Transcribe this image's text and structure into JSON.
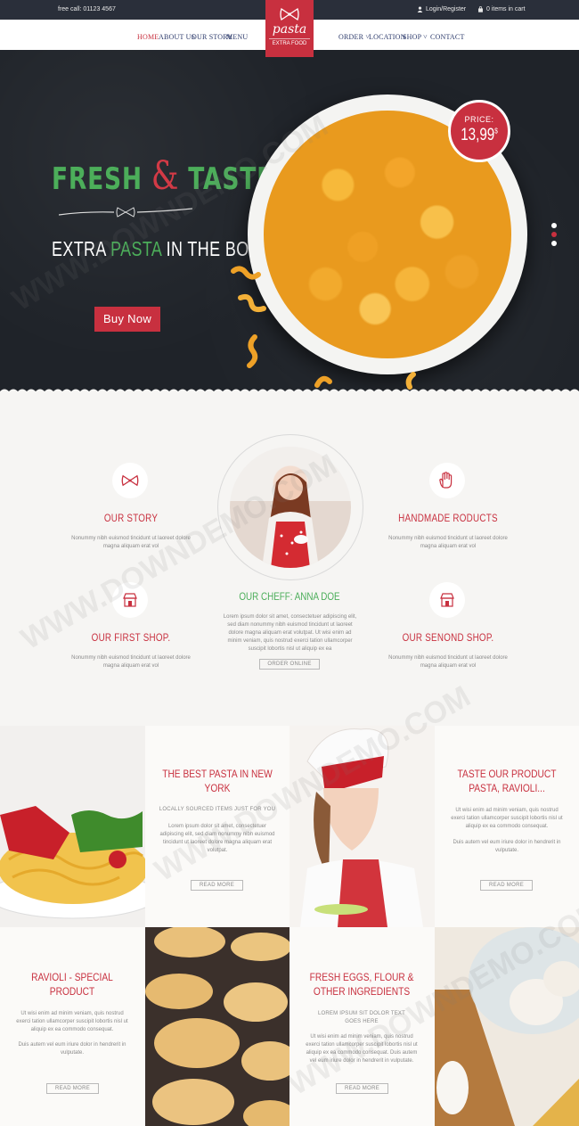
{
  "topbar": {
    "phone": "free call: 01123 4567",
    "login": "Login/Register",
    "cart": "0 items in cart"
  },
  "nav": {
    "left": [
      "HOME",
      "ABOUT US",
      "OUR STORY",
      "MENU"
    ],
    "right": [
      "ORDER",
      "LOCATION",
      "SHOP",
      "CONTACT"
    ],
    "active": "HOME"
  },
  "logo": {
    "name": "pasta",
    "sub": "EXTRA FOOD"
  },
  "hero": {
    "title_left": "FRESH",
    "title_amp": "&",
    "title_right": "TASTE",
    "sub_a": "EXTRA",
    "sub_hl": "PASTA",
    "sub_b": "IN THE BOX",
    "button": "Buy Now",
    "price_label": "PRICE:",
    "price_value": "13,99",
    "price_currency": "$"
  },
  "about": {
    "our_story": {
      "title": "OUR STORY",
      "text": "Nonummy nibh euismod tincidunt ut laoreet dolore magna aliquam erat vol"
    },
    "handmade": {
      "title": "HANDMADE RODUCTS",
      "text": "Nonummy nibh euismod tincidunt ut laoreet dolore magna aliquam erat vol"
    },
    "first_shop": {
      "title": "OUR FIRST SHOP.",
      "text": "Nonummy nibh euismod tincidunt ut laoreet dolore magna aliquam erat vol"
    },
    "second_shop": {
      "title": "OUR SENOND SHOP.",
      "text": "Nonummy nibh euismod tincidunt ut laoreet dolore magna aliquam erat vol"
    },
    "chef": {
      "title": "OUR CHEFF: ANNA DOE",
      "text": "Lorem ipsum dolor sit amet, consectetuer adipiscing elit, sed diam nonummy nibh euismod tincidunt ut laoreet dolore magna aliquam erat volutpat. Ut wisi enim ad minim veniam, quis nostrud exerci tation ullamcorper suscipit lobortis nisl ut aliquip ex ea",
      "button": "ORDER ONLINE"
    }
  },
  "row1": {
    "best": {
      "title": "THE BEST PASTA IN NEW YORK",
      "kicker": "LOCALLY SOURCED ITEMS JUST FOR YOU",
      "text": "Lorem ipsum dolor sit amet, consectetuer adipiscing elit, sed diam nonummy nibh euismod tincidunt ut laoreet dolore magna aliquam erat volutpat.",
      "button": "READ MORE"
    },
    "taste": {
      "title": "TASTE OUR PRODUCT PASTA, RAVIOLI...",
      "text1": "Ut wisi enim ad minim veniam, quis nostrud exerci tation ullamcorper suscipit lobortis nisl ut aliquip ex ea commodo consequat.",
      "text2": "Duis autem vel eum iriure dolor in hendrerit in vulputate.",
      "button": "READ MORE"
    }
  },
  "row2": {
    "ravioli": {
      "title": "RAVIOLI - SPECIAL PRODUCT",
      "text1": "Ut wisi enim ad minim veniam, quis nostrud exerci tation ullamcorper suscipit lobortis nisl ut aliquip ex ea commodo consequat.",
      "text2": "Duis autem vel eum iriure dolor in hendrerit in vulputate.",
      "button": "READ MORE"
    },
    "eggs": {
      "title": "FRESH EGGS, FLOUR & OTHER INGREDIENTS",
      "kicker": "LOREM IPSUM SIT DOLOR TEXT GOES HERE",
      "text": "Ut wisi enim ad minim veniam, quis nostrud exerci tation ullamcorper suscipit lobortis nisl ut aliquip ex ea commodo consequat. Duis autem vel eum iriure dolor in hendrerit in vulputate.",
      "button": "READ MORE"
    }
  },
  "colors": {
    "brand_red": "#c8303f",
    "brand_green": "#4cae5a",
    "navy": "#2c3a6b",
    "topbar": "#2a2f3a"
  }
}
